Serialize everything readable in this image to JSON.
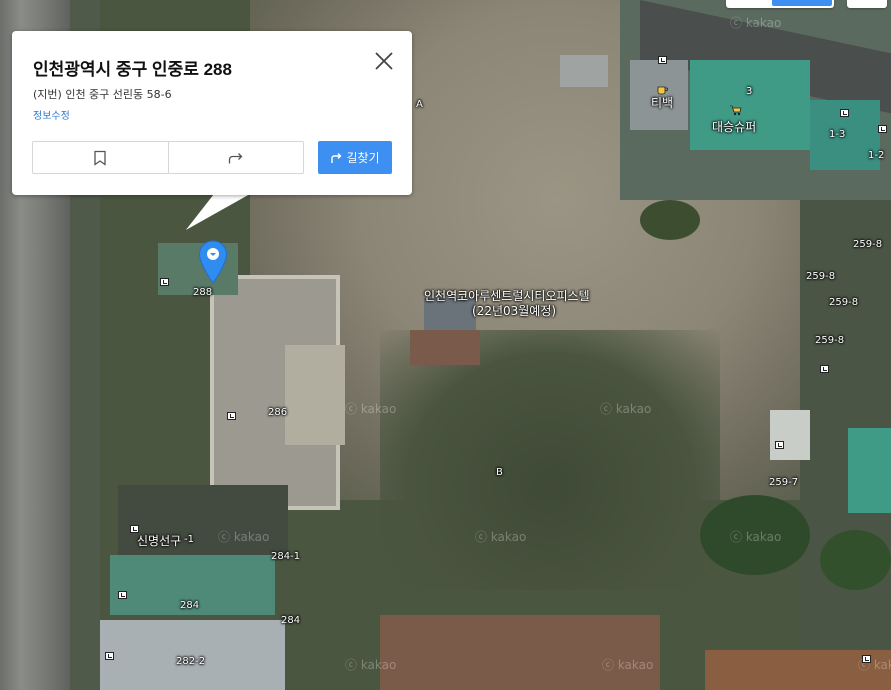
{
  "popup": {
    "title": "인천광역시 중구 인중로 288",
    "jibun": "(지번) 인천 중구 선린동 58-6",
    "edit_link": "정보수정",
    "route_label": "길찾기",
    "bookmark_icon": "bookmark-icon",
    "share_icon": "share-icon",
    "close_icon": "close-icon"
  },
  "marker": {
    "label": "288",
    "color": "#2f8cf0"
  },
  "map_labels": {
    "site_name": "인천역코아루센트럴시티오피스텔",
    "site_note": "(22년03월예정)",
    "tibaek": "티백",
    "daeseung": "대승슈퍼",
    "sinmyeong": "신명선구",
    "sinmyeong_suffix": "-1",
    "letter_a": "A",
    "letter_b": "B",
    "n286": "286",
    "n284_1": "284-1",
    "n284a": "284",
    "n284b": "284",
    "n282_2": "282-2",
    "n1_3": "1-3",
    "n1_2": "1-2",
    "n259_8a": "259-8",
    "n259_8b": "259-8",
    "n259_8c": "259-8",
    "n259_8d": "259-8",
    "n259_7": "259-7",
    "n3": "3"
  },
  "watermark": "ⓒ kakao",
  "colors": {
    "accent": "#3d8ff2",
    "link": "#2a7bd6"
  }
}
